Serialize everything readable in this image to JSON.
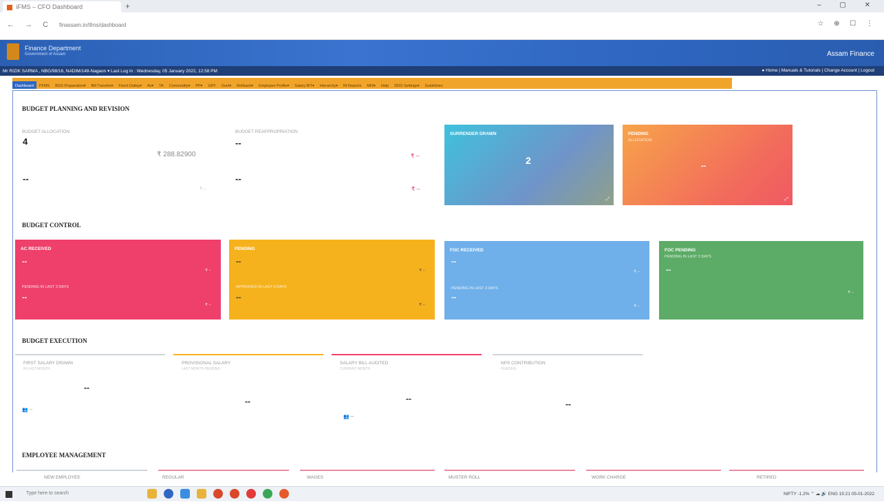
{
  "browser": {
    "tab_title": "iFMS – CFO Dashboard",
    "new_tab": "+",
    "window_controls": "–  ▢  ✕",
    "nav_buttons": "←  →  C",
    "url": "finassam.in/ifms/dashboard",
    "toolbar_icons": "☆  ⊕  ☐  ⋮"
  },
  "header": {
    "department": "Finance Department",
    "sub": "Government of Assam",
    "brand_right": "Assam Finance",
    "user_info": "Mr RIZIK SARMA , NBG/98/16, NADIM/148-Nagaon ▾  Last Log In : Wednesday, 05 January 2022, 12:58 PM",
    "user_links": "● Home | Manuals & Tutorials | Change Account | Logout"
  },
  "menu": {
    "active": "Dashboard",
    "items": [
      "PFMS",
      "BGS Preparation▾",
      "Bill Transfer▾",
      "Fixed Outlay▾",
      "Av▾",
      "TA",
      "Commodity▾",
      "PP▾",
      "GPF",
      "Govt▾",
      "Rollback▾",
      "Employee Profile▾",
      "Salary BIT▾",
      "Hierarchy▾",
      "Rt Reports",
      "MIS▾",
      "Help",
      "DDO Settings▾",
      "Guidelines"
    ]
  },
  "budget_planning": {
    "title": "BUDGET PLANNING AND REVISION",
    "allocation_label": "BUDGET ALLOCATION",
    "allocation_value": "4",
    "allocation_amount": "₹ 288.82900",
    "sub_label_1": "",
    "sub_value_1": "--",
    "sub_rupee_1": "₹ --",
    "reappropriation_label": "BUDGET REAPPROPRIATION",
    "reappropriation_value": "--",
    "reappropriation_rupee": "₹ --",
    "sub_label_2": "",
    "sub_value_2": "--",
    "sub_rupee_2": "₹ --",
    "tile1_title": "SURRENDER DRAWN",
    "tile1_value": "2",
    "tile2_title": "PENDING",
    "tile2_sub": "ALLOCATION",
    "tile2_value": "--"
  },
  "budget_control": {
    "title": "BUDGET CONTROL",
    "tiles": [
      {
        "title": "AC RECEIVED",
        "v1": "--",
        "r1": "₹ --",
        "sub": "PENDING IN LAST 3 DAYS",
        "v2": "--",
        "r2": "₹ --"
      },
      {
        "title": "PENDING",
        "v1": "--",
        "r1": "₹ --",
        "sub": "APPROVED IN LAST 3 DAYS",
        "v2": "--",
        "r2": "₹ --"
      },
      {
        "title": "FOC RECEIVED",
        "v1": "--",
        "r1": "₹ --",
        "sub": "PENDING IN LAST 3 DAYS",
        "v2": "--",
        "r2": "₹ --"
      },
      {
        "title": "FOC PENDING",
        "sub": "PENDING IN LAST 3 DAYS",
        "v1": "--",
        "r1": "₹ --"
      }
    ]
  },
  "budget_execution": {
    "title": "BUDGET EXECUTION",
    "cards": [
      {
        "title": "FIRST SALARY DRAWN",
        "sub": "IN LAST MONTH",
        "value": "--"
      },
      {
        "title": "PROVISIONAL SALARY",
        "sub": "LAST MONTH PENDING",
        "value": "--"
      },
      {
        "title": "SALARY BILL AUDITED",
        "sub": "CURRENT MONTH",
        "value": "--"
      },
      {
        "title": "NPS CONTRIBUTION",
        "sub": "PENDING",
        "value": "--"
      }
    ],
    "badge1": "--",
    "badge2": "--"
  },
  "employee_management": {
    "title": "EMPLOYEE MANAGEMENT",
    "cards": [
      "NEW EMPLOYEE",
      "REGULAR",
      "WAGES",
      "MUSTER ROLL",
      "WORK CHARGE",
      "RETIRED"
    ]
  },
  "taskbar": {
    "search": "Type here to search",
    "tray": "NIFTY  -1.2%   ⌃ ☁ 🔊   ENG   15:21  05-01-2022"
  },
  "colors": {
    "brand_blue": "#2f67c2",
    "menu_orange": "#f0a52a",
    "pink": "#ef3f6b",
    "amber": "#f6b21d",
    "sky": "#6fb0ea",
    "green": "#5cab66"
  }
}
